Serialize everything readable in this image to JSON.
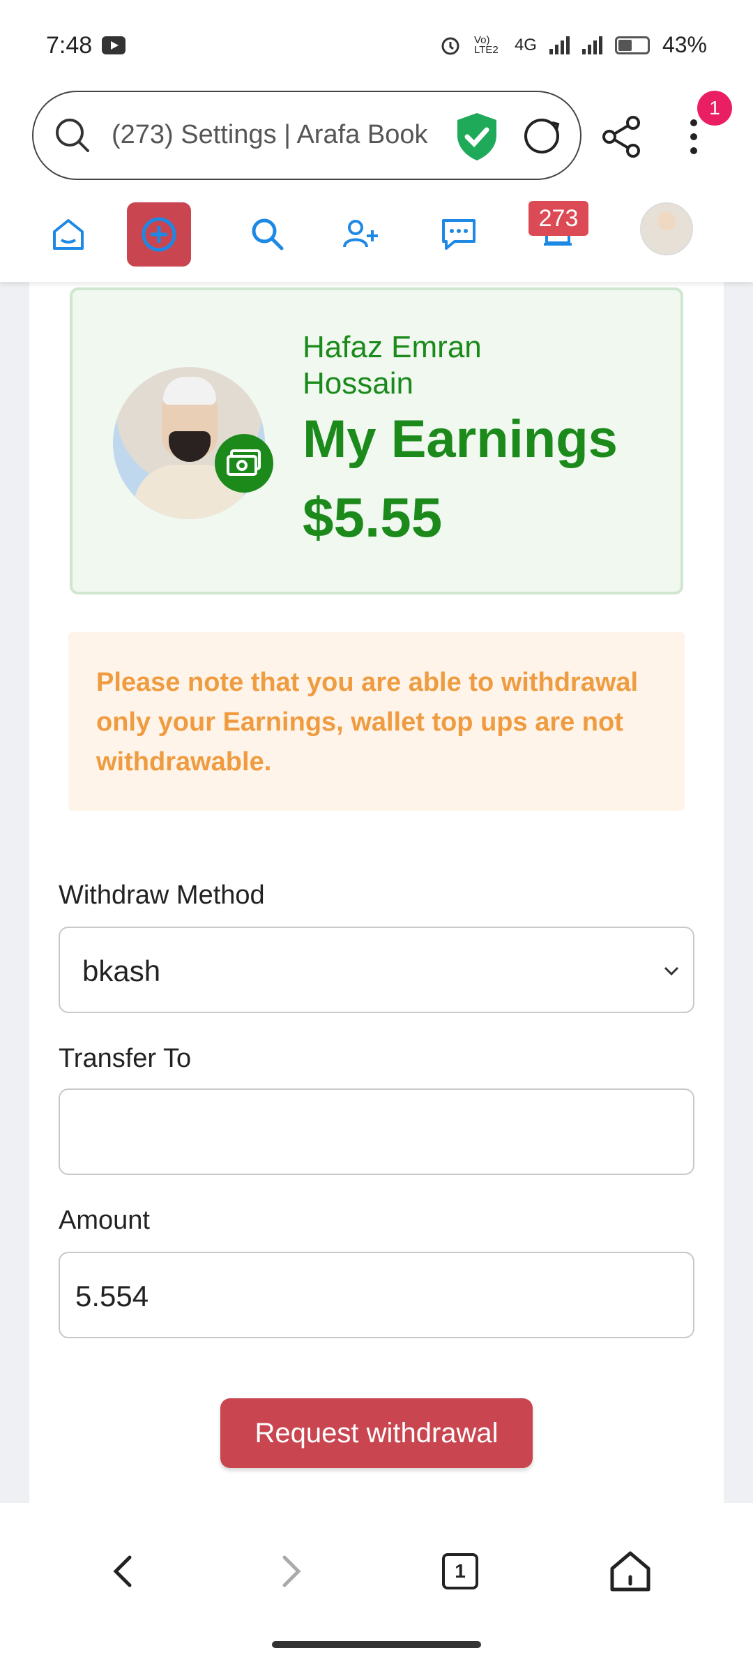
{
  "status_bar": {
    "time": "7:48",
    "battery": "43%",
    "battery_level": 0.43,
    "network": "4G",
    "volte": "Vo) LTE2"
  },
  "browser": {
    "url_text": "(273) Settings | Arafa Book",
    "menu_badge": "1"
  },
  "app_nav": {
    "notification_count": "273"
  },
  "earnings": {
    "name": "Hafaz Emran Hossain",
    "title": "My Earnings",
    "amount": "$5.55"
  },
  "note": "Please note that you are able to withdrawal only your Earnings, wallet top ups are not withdrawable.",
  "form": {
    "method_label": "Withdraw Method",
    "method_value": "bkash",
    "transfer_label": "Transfer To",
    "transfer_value": "",
    "amount_label": "Amount",
    "amount_value": "5.554",
    "submit_label": "Request withdrawal"
  },
  "bottom_nav": {
    "tab_count": "1"
  },
  "colors": {
    "accent": "#c9454f",
    "green": "#1b8a1b",
    "note_text": "#ef9b40",
    "link_blue": "#1e88e5"
  }
}
